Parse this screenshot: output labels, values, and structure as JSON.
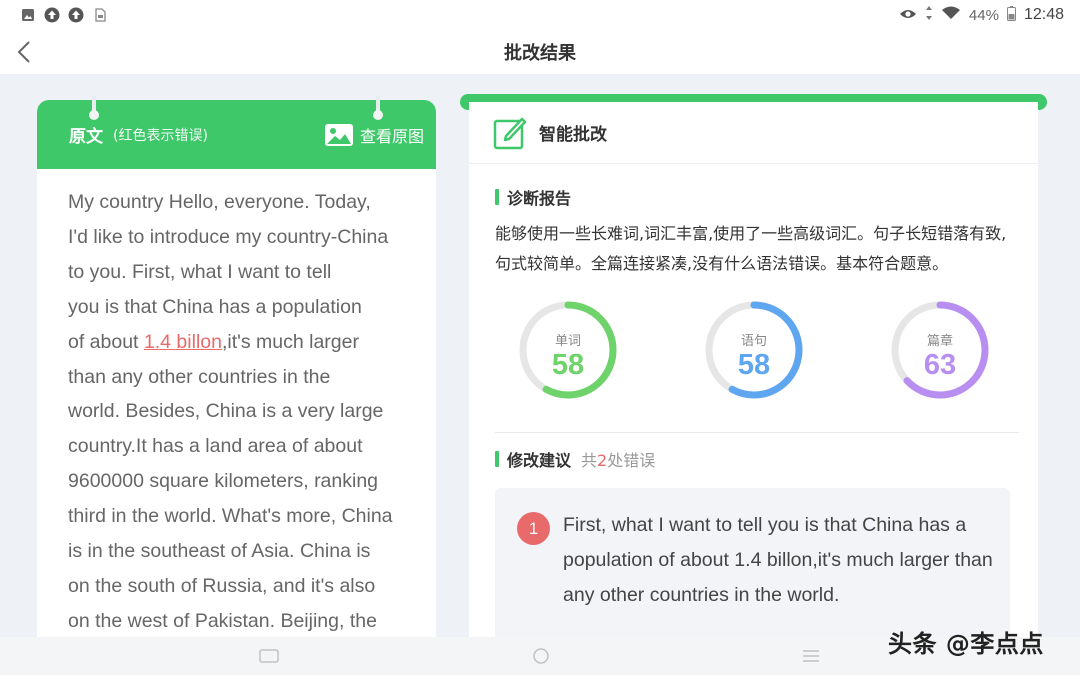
{
  "status_bar": {
    "left_icons": [
      "image-icon",
      "upload-icon",
      "upload-icon",
      "sim-icon"
    ],
    "battery": "44%",
    "time": "12:48"
  },
  "header": {
    "title": "批改结果"
  },
  "original": {
    "title": "原文",
    "note": "(红色表示错误)",
    "view_button": "查看原图",
    "lines_before": [
      "My country  Hello, everyone. Today,",
      "I'd like to introduce my country-China",
      "to you.  First, what I want to tell",
      "you is that China has a population"
    ],
    "error_prefix": "of about ",
    "error_text": "1.4 billon",
    "error_suffix": ",it's much larger",
    "lines_after": [
      "than any other countries in the",
      "world. Besides, China is a very large",
      "country.It has a land area of about",
      "9600000 square kilometers, ranking",
      "third in the world. What's more, China",
      "is in the southeast of Asia. China is",
      "on the south of Russia, and it's also",
      "on the west of Pakistan. Beijing, the"
    ]
  },
  "smart": {
    "title": "智能批改",
    "diagnosis_title": "诊断报告",
    "diagnosis_text": "能够使用一些长难词,词汇丰富,使用了一些高级词汇。句子长短错落有致,句式较简单。全篇连接紧凑,没有什么语法错误。基本符合题意。",
    "scores": [
      {
        "label": "单词",
        "value": "58",
        "fraction": 0.58,
        "color": "#6dd36a"
      },
      {
        "label": "语句",
        "value": "58",
        "fraction": 0.58,
        "color": "#5fa6f0"
      },
      {
        "label": "篇章",
        "value": "63",
        "fraction": 0.63,
        "color": "#b88ff0"
      }
    ],
    "suggestion_title": "修改建议",
    "suggestion_count_prefix": "共",
    "suggestion_count": "2",
    "suggestion_count_suffix": "处错误",
    "suggestion_index": "1",
    "suggestion_text": "First, what I want to tell you is that China has a population of about 1.4 billon,it's much larger than any other countries in the world."
  },
  "watermark": "头条 @李点点",
  "colors": {
    "accent": "#3fc86a",
    "error": "#e86a6a"
  }
}
